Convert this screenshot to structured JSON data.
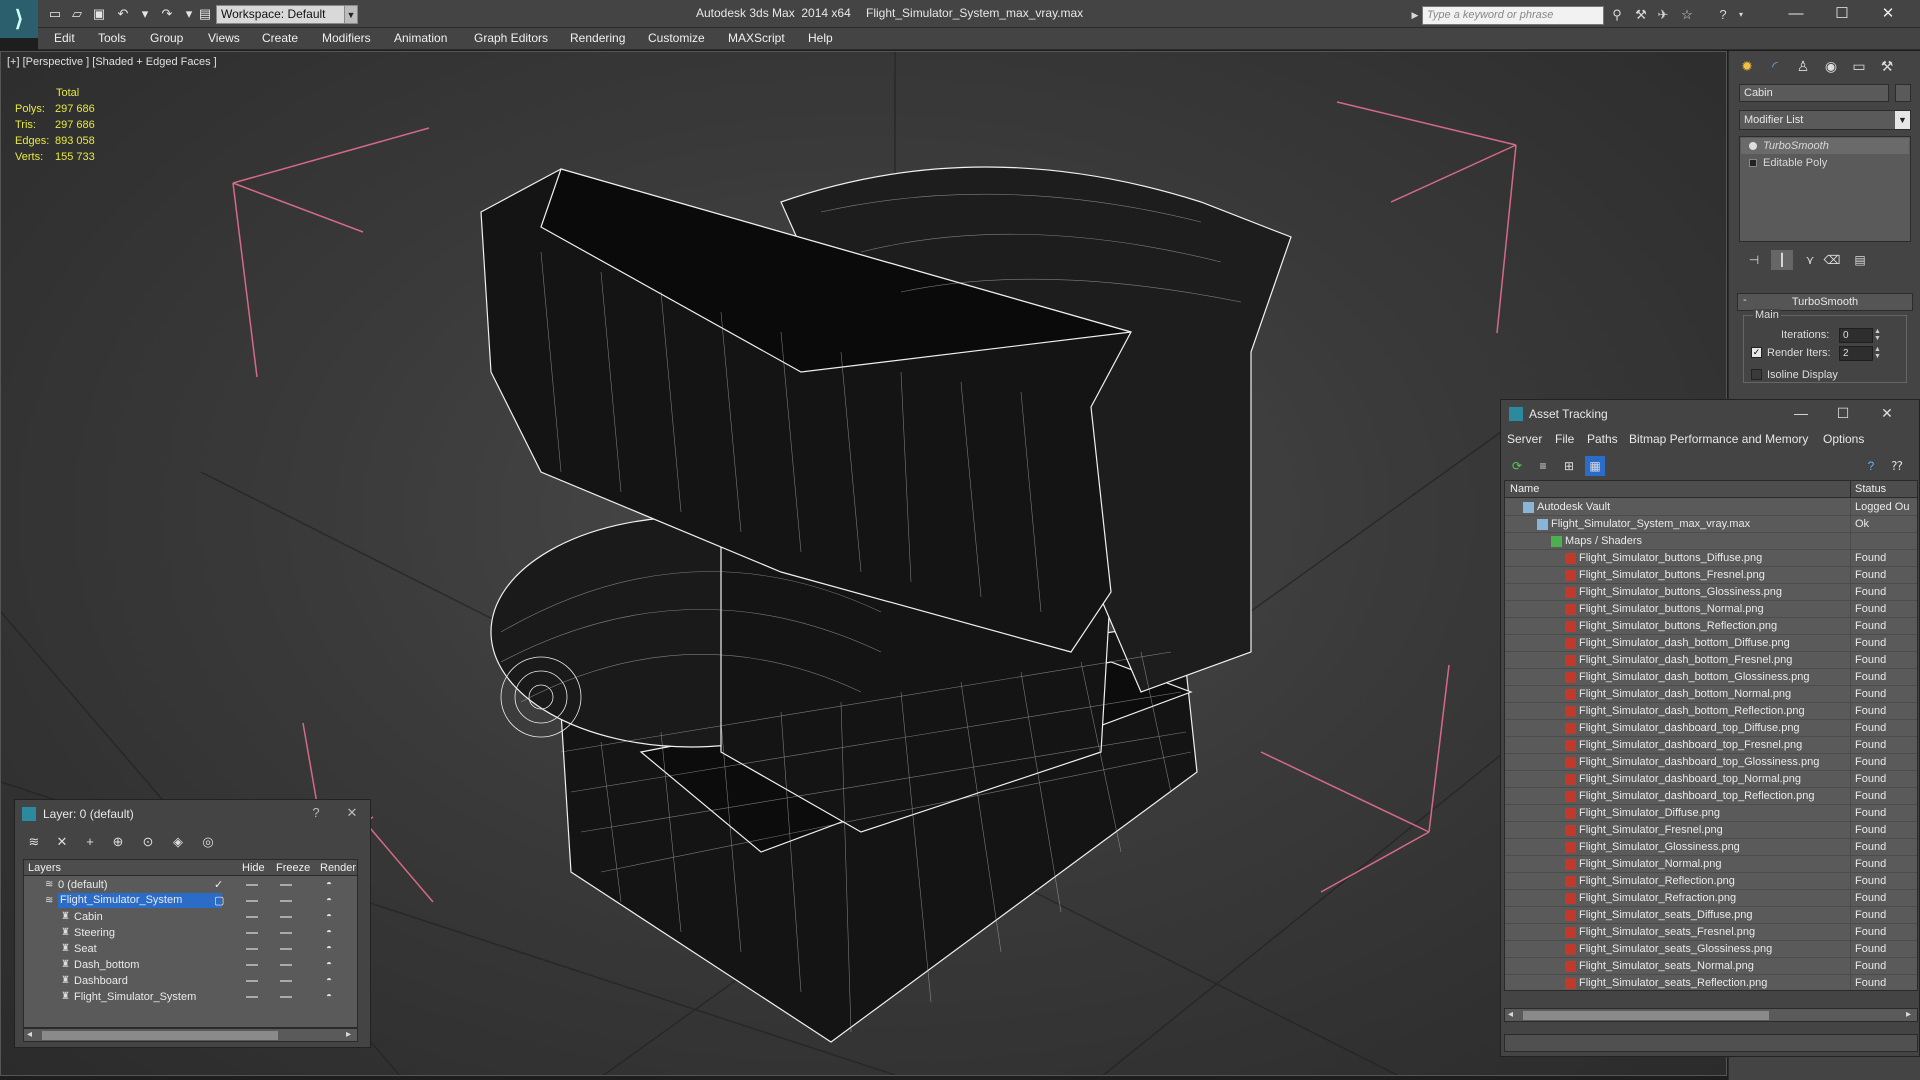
{
  "titlebar": {
    "workspace": "Workspace: Default",
    "app_title": "Autodesk 3ds Max  2014 x64",
    "file_title": "Flight_Simulator_System_max_vray.max",
    "search_placeholder": "Type a keyword or phrase"
  },
  "menu": [
    "Edit",
    "Tools",
    "Group",
    "Views",
    "Create",
    "Modifiers",
    "Animation",
    "Graph Editors",
    "Rendering",
    "Customize",
    "MAXScript",
    "Help"
  ],
  "viewport": {
    "label": "[+] [Perspective ] [Shaded + Edged Faces ]",
    "stats": {
      "header": "Total",
      "polys_label": "Polys:",
      "polys": "297 686",
      "tris_label": "Tris:",
      "tris": "297 686",
      "edges_label": "Edges:",
      "edges": "893 058",
      "verts_label": "Verts:",
      "verts": "155 733"
    }
  },
  "command_panel": {
    "object_name": "Cabin",
    "modifier_list": "Modifier List",
    "stack": [
      "TurboSmooth",
      "Editable Poly"
    ],
    "rollout_title": "TurboSmooth",
    "main_group": "Main",
    "iterations_label": "Iterations:",
    "iterations_value": "0",
    "render_iters_label": "Render Iters:",
    "render_iters_value": "2",
    "isoline_label": "Isoline Display"
  },
  "asset_tracking": {
    "title": "Asset Tracking",
    "menu": [
      "Server",
      "File",
      "Paths",
      "Bitmap Performance and Memory",
      "Options"
    ],
    "col_name": "Name",
    "col_status": "Status",
    "rows": [
      {
        "name": "Autodesk Vault",
        "status": "Logged Ou",
        "level": 0,
        "icon": "vault-icon"
      },
      {
        "name": "Flight_Simulator_System_max_vray.max",
        "status": "Ok",
        "level": 1,
        "icon": "max-file-icon"
      },
      {
        "name": "Maps / Shaders",
        "status": "",
        "level": 2,
        "icon": "maps-folder-icon"
      },
      {
        "name": "Flight_Simulator_buttons_Diffuse.png",
        "status": "Found",
        "level": 3,
        "icon": "png-icon"
      },
      {
        "name": "Flight_Simulator_buttons_Fresnel.png",
        "status": "Found",
        "level": 3,
        "icon": "png-icon"
      },
      {
        "name": "Flight_Simulator_buttons_Glossiness.png",
        "status": "Found",
        "level": 3,
        "icon": "png-icon"
      },
      {
        "name": "Flight_Simulator_buttons_Normal.png",
        "status": "Found",
        "level": 3,
        "icon": "png-icon"
      },
      {
        "name": "Flight_Simulator_buttons_Reflection.png",
        "status": "Found",
        "level": 3,
        "icon": "png-icon"
      },
      {
        "name": "Flight_Simulator_dash_bottom_Diffuse.png",
        "status": "Found",
        "level": 3,
        "icon": "png-icon"
      },
      {
        "name": "Flight_Simulator_dash_bottom_Fresnel.png",
        "status": "Found",
        "level": 3,
        "icon": "png-icon"
      },
      {
        "name": "Flight_Simulator_dash_bottom_Glossiness.png",
        "status": "Found",
        "level": 3,
        "icon": "png-icon"
      },
      {
        "name": "Flight_Simulator_dash_bottom_Normal.png",
        "status": "Found",
        "level": 3,
        "icon": "png-icon"
      },
      {
        "name": "Flight_Simulator_dash_bottom_Reflection.png",
        "status": "Found",
        "level": 3,
        "icon": "png-icon"
      },
      {
        "name": "Flight_Simulator_dashboard_top_Diffuse.png",
        "status": "Found",
        "level": 3,
        "icon": "png-icon"
      },
      {
        "name": "Flight_Simulator_dashboard_top_Fresnel.png",
        "status": "Found",
        "level": 3,
        "icon": "png-icon"
      },
      {
        "name": "Flight_Simulator_dashboard_top_Glossiness.png",
        "status": "Found",
        "level": 3,
        "icon": "png-icon"
      },
      {
        "name": "Flight_Simulator_dashboard_top_Normal.png",
        "status": "Found",
        "level": 3,
        "icon": "png-icon"
      },
      {
        "name": "Flight_Simulator_dashboard_top_Reflection.png",
        "status": "Found",
        "level": 3,
        "icon": "png-icon"
      },
      {
        "name": "Flight_Simulator_Diffuse.png",
        "status": "Found",
        "level": 3,
        "icon": "png-icon"
      },
      {
        "name": "Flight_Simulator_Fresnel.png",
        "status": "Found",
        "level": 3,
        "icon": "png-icon"
      },
      {
        "name": "Flight_Simulator_Glossiness.png",
        "status": "Found",
        "level": 3,
        "icon": "png-icon"
      },
      {
        "name": "Flight_Simulator_Normal.png",
        "status": "Found",
        "level": 3,
        "icon": "png-icon"
      },
      {
        "name": "Flight_Simulator_Reflection.png",
        "status": "Found",
        "level": 3,
        "icon": "png-icon"
      },
      {
        "name": "Flight_Simulator_Refraction.png",
        "status": "Found",
        "level": 3,
        "icon": "png-icon"
      },
      {
        "name": "Flight_Simulator_seats_Diffuse.png",
        "status": "Found",
        "level": 3,
        "icon": "png-icon"
      },
      {
        "name": "Flight_Simulator_seats_Fresnel.png",
        "status": "Found",
        "level": 3,
        "icon": "png-icon"
      },
      {
        "name": "Flight_Simulator_seats_Glossiness.png",
        "status": "Found",
        "level": 3,
        "icon": "png-icon"
      },
      {
        "name": "Flight_Simulator_seats_Normal.png",
        "status": "Found",
        "level": 3,
        "icon": "png-icon"
      },
      {
        "name": "Flight_Simulator_seats_Reflection.png",
        "status": "Found",
        "level": 3,
        "icon": "png-icon"
      }
    ]
  },
  "layers": {
    "title": "Layer: 0 (default)",
    "help": "?",
    "col_layers": "Layers",
    "col_hide": "Hide",
    "col_freeze": "Freeze",
    "col_render": "Render",
    "rows": [
      {
        "name": "0 (default)",
        "level": 0,
        "selected": false,
        "checked": true
      },
      {
        "name": "Flight_Simulator_System",
        "level": 0,
        "selected": true,
        "checked": false
      },
      {
        "name": "Cabin",
        "level": 1,
        "selected": false,
        "checked": false
      },
      {
        "name": "Steering",
        "level": 1,
        "selected": false,
        "checked": false
      },
      {
        "name": "Seat",
        "level": 1,
        "selected": false,
        "checked": false
      },
      {
        "name": "Dash_bottom",
        "level": 1,
        "selected": false,
        "checked": false
      },
      {
        "name": "Dashboard",
        "level": 1,
        "selected": false,
        "checked": false
      },
      {
        "name": "Flight_Simulator_System",
        "level": 1,
        "selected": false,
        "checked": false
      }
    ]
  },
  "colors": {
    "ui_bg": "#444444",
    "viewport_bg": "#3a3a3a",
    "stats_text": "#e8e840",
    "selection": "#2a6cc8",
    "png_icon": "#c0392b"
  }
}
